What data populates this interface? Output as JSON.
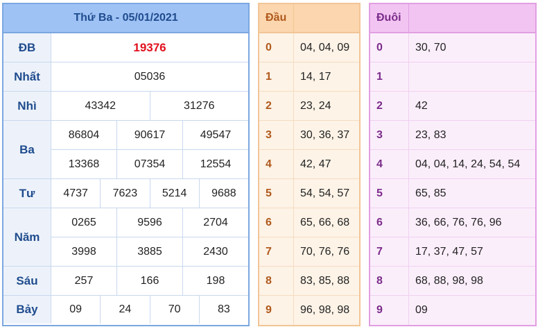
{
  "results": {
    "title": "Thứ Ba - 05/01/2021",
    "rows": [
      {
        "label": "ĐB",
        "lines": [
          [
            "19376"
          ]
        ]
      },
      {
        "label": "Nhất",
        "lines": [
          [
            "05036"
          ]
        ]
      },
      {
        "label": "Nhì",
        "lines": [
          [
            "43342",
            "31276"
          ]
        ]
      },
      {
        "label": "Ba",
        "lines": [
          [
            "86804",
            "90617",
            "49547"
          ],
          [
            "13368",
            "07354",
            "12554"
          ]
        ]
      },
      {
        "label": "Tư",
        "lines": [
          [
            "4737",
            "7623",
            "5214",
            "9688"
          ]
        ]
      },
      {
        "label": "Năm",
        "lines": [
          [
            "0265",
            "9596",
            "2704"
          ],
          [
            "3998",
            "3885",
            "2430"
          ]
        ]
      },
      {
        "label": "Sáu",
        "lines": [
          [
            "257",
            "166",
            "198"
          ]
        ]
      },
      {
        "label": "Bảy",
        "lines": [
          [
            "09",
            "24",
            "70",
            "83"
          ]
        ]
      }
    ]
  },
  "dau": {
    "header": "Đầu",
    "rows": [
      {
        "k": "0",
        "v": "04, 04, 09"
      },
      {
        "k": "1",
        "v": "14, 17"
      },
      {
        "k": "2",
        "v": "23, 24"
      },
      {
        "k": "3",
        "v": "30, 36, 37"
      },
      {
        "k": "4",
        "v": "42, 47"
      },
      {
        "k": "5",
        "v": "54, 54, 57"
      },
      {
        "k": "6",
        "v": "65, 66, 68"
      },
      {
        "k": "7",
        "v": "70, 76, 76"
      },
      {
        "k": "8",
        "v": "83, 85, 88"
      },
      {
        "k": "9",
        "v": "96, 98, 98"
      }
    ]
  },
  "duoi": {
    "header": "Đuôi",
    "rows": [
      {
        "k": "0",
        "v": "30, 70"
      },
      {
        "k": "1",
        "v": ""
      },
      {
        "k": "2",
        "v": "42"
      },
      {
        "k": "3",
        "v": "23, 83"
      },
      {
        "k": "4",
        "v": "04, 04, 14, 24, 54, 54"
      },
      {
        "k": "5",
        "v": "65, 85"
      },
      {
        "k": "6",
        "v": "36, 66, 76, 76, 96"
      },
      {
        "k": "7",
        "v": "17, 37, 47, 57"
      },
      {
        "k": "8",
        "v": "68, 88, 98, 98"
      },
      {
        "k": "9",
        "v": "09"
      }
    ]
  },
  "colors": {
    "special_prize": "#e0101c",
    "results_accent": "#9fc2f5",
    "dau_accent": "#fbd6ae",
    "duoi_accent": "#f2c4f2"
  }
}
